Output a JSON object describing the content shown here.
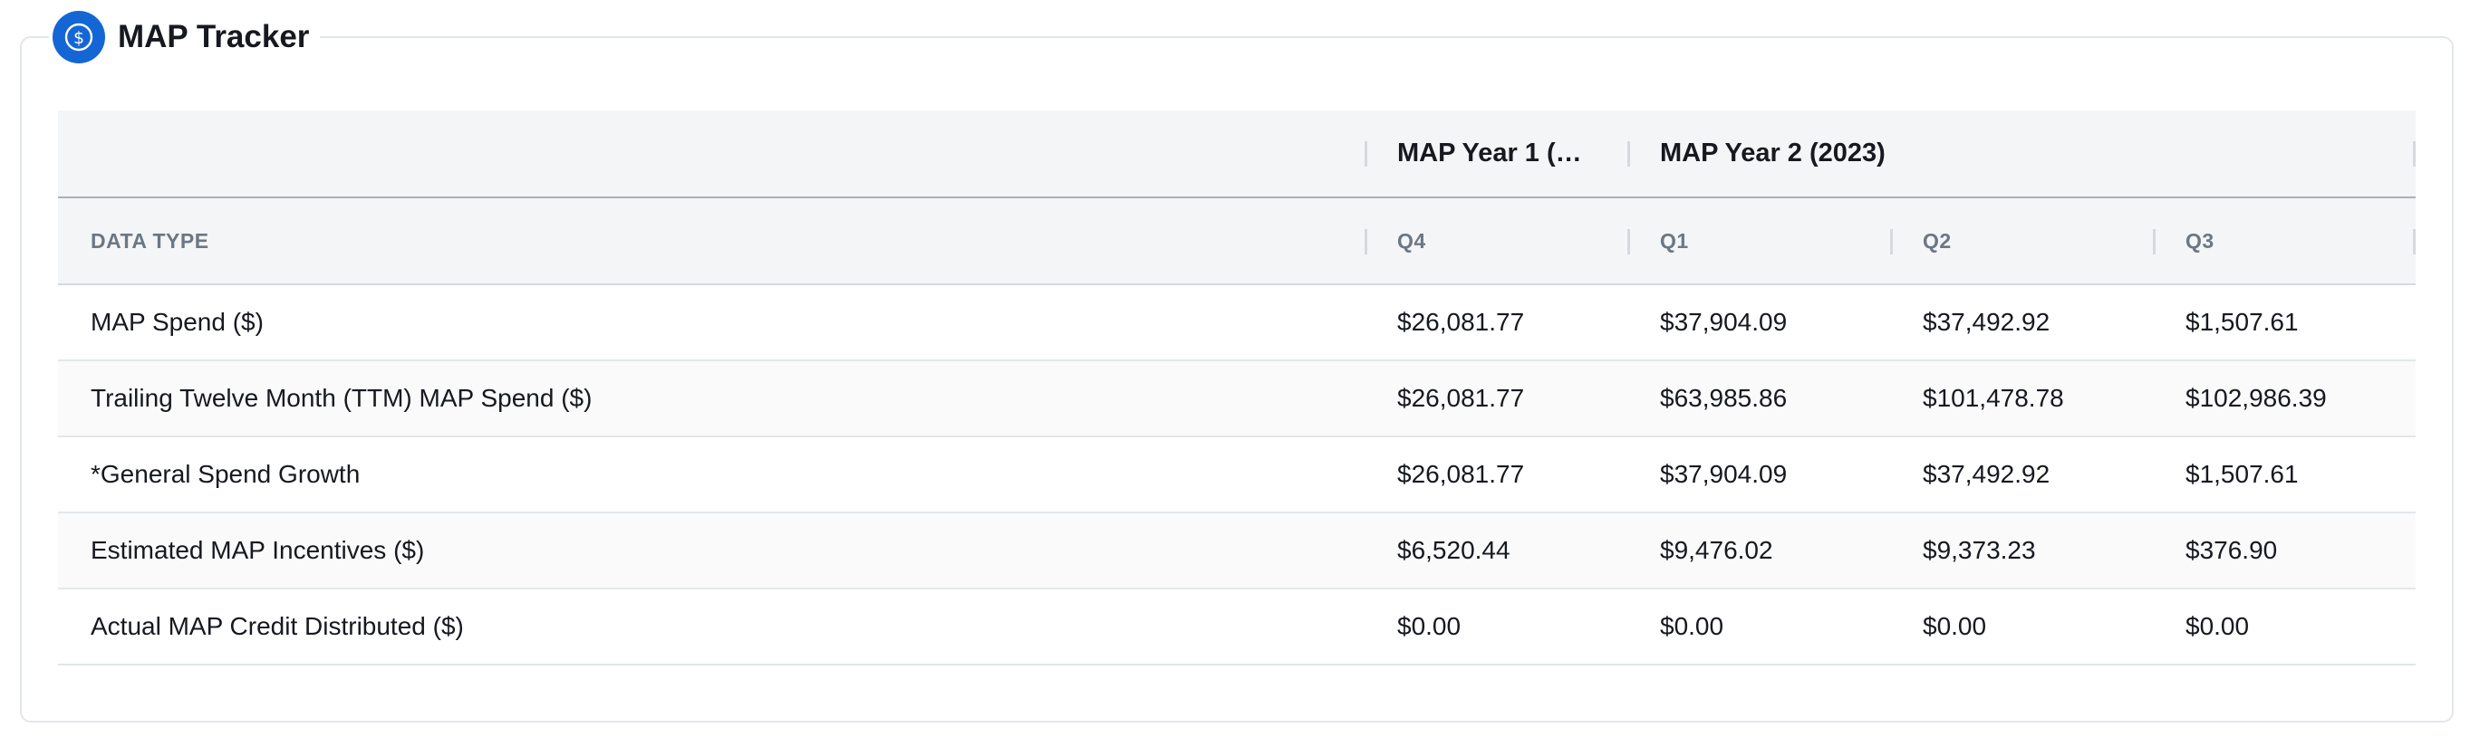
{
  "panel": {
    "title": "MAP Tracker",
    "icon": "dollar-circle-icon",
    "accent_color": "#1466d4"
  },
  "table": {
    "group_headers": {
      "year1": "MAP Year 1 (…",
      "year2": "MAP Year 2 (2023)"
    },
    "column_headers": {
      "data_type": "DATA TYPE",
      "q4": "Q4",
      "q1": "Q1",
      "q2": "Q2",
      "q3": "Q3"
    },
    "rows": [
      {
        "label": "MAP Spend ($)",
        "values": [
          "$26,081.77",
          "$37,904.09",
          "$37,492.92",
          "$1,507.61"
        ]
      },
      {
        "label": "Trailing Twelve Month (TTM) MAP Spend ($)",
        "values": [
          "$26,081.77",
          "$63,985.86",
          "$101,478.78",
          "$102,986.39"
        ]
      },
      {
        "label": "*General Spend Growth",
        "values": [
          "$26,081.77",
          "$37,904.09",
          "$37,492.92",
          "$1,507.61"
        ]
      },
      {
        "label": "Estimated MAP Incentives ($)",
        "values": [
          "$6,520.44",
          "$9,476.02",
          "$9,373.23",
          "$376.90"
        ]
      },
      {
        "label": "Actual MAP Credit Distributed ($)",
        "values": [
          "$0.00",
          "$0.00",
          "$0.00",
          "$0.00"
        ]
      }
    ]
  }
}
